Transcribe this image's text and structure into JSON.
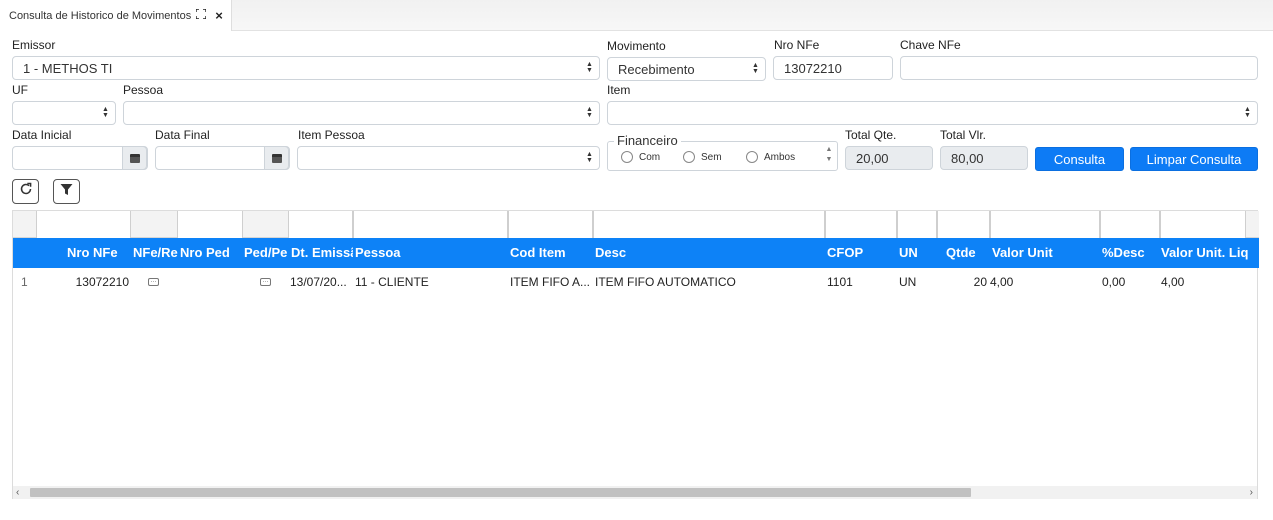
{
  "tab": {
    "title": "Consulta de Historico de Movimentos",
    "expand_icon": "expand-icon",
    "close_label": "×"
  },
  "filters": {
    "emissor": {
      "label": "Emissor",
      "value": "1 - METHOS TI"
    },
    "movimento": {
      "label": "Movimento",
      "value": "Recebimento"
    },
    "nro_nfe": {
      "label": "Nro NFe",
      "value": "13072210"
    },
    "chave_nfe": {
      "label": "Chave NFe",
      "value": ""
    },
    "uf": {
      "label": "UF",
      "value": ""
    },
    "pessoa": {
      "label": "Pessoa",
      "value": ""
    },
    "item": {
      "label": "Item",
      "value": ""
    },
    "data_inicial": {
      "label": "Data Inicial",
      "value": ""
    },
    "data_final": {
      "label": "Data Final",
      "value": ""
    },
    "item_pessoa": {
      "label": "Item Pessoa",
      "value": ""
    },
    "financeiro": {
      "legend": "Financeiro",
      "options": [
        "Com",
        "Sem",
        "Ambos"
      ]
    },
    "total_qte": {
      "label": "Total Qte.",
      "value": "20,00"
    },
    "total_vlr": {
      "label": "Total Vlr.",
      "value": "80,00"
    }
  },
  "buttons": {
    "consulta": "Consulta",
    "limpar": "Limpar Consulta"
  },
  "toolbar": {
    "refresh_icon": "refresh-icon",
    "filter_icon": "filter-icon"
  },
  "grid": {
    "columns": [
      "Nro NFe",
      "NFe/Re",
      "Nro Ped",
      "Ped/Pe",
      "Dt. Emissã",
      "Pessoa",
      "Cod Item",
      "Desc",
      "CFOP",
      "UN",
      "Qtde",
      "Valor Unit",
      "%Desc",
      "Valor Unit. Liq"
    ],
    "rows": [
      {
        "index": "1",
        "nro_nfe": "13072210",
        "nfe_re": "…",
        "nro_ped": "",
        "ped_pe": "…",
        "dt_emissao": "13/07/20...",
        "pessoa": "11 - CLIENTE",
        "cod_item": "ITEM FIFO A...",
        "desc": "ITEM FIFO AUTOMATICO",
        "cfop": "1101",
        "un": "UN",
        "qtde": "20",
        "valor_unit": "4,00",
        "pct_desc": "0,00",
        "valor_unit_liq": "4,00"
      }
    ]
  },
  "scroll": {
    "left_arrow": "‹",
    "right_arrow": "›"
  }
}
